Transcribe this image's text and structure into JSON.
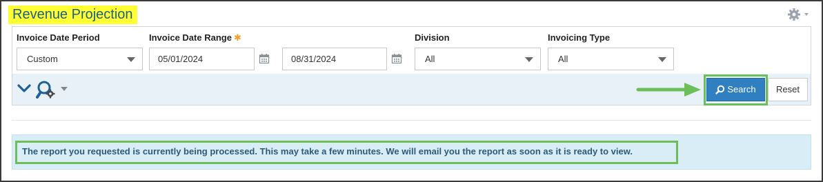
{
  "page": {
    "title": "Revenue Projection"
  },
  "header": {
    "settings_icon": "gear-icon",
    "settings_menu_icon": "caret-down-icon"
  },
  "filters": {
    "invoice_date_period": {
      "label": "Invoice Date Period",
      "value": "Custom"
    },
    "invoice_date_range": {
      "label": "Invoice Date Range",
      "required_marker": "✱",
      "start_value": "05/01/2024",
      "end_value": "08/31/2024",
      "calendar_icon": "calendar-icon"
    },
    "division": {
      "label": "Division",
      "value": "All"
    },
    "invoicing_type": {
      "label": "Invoicing Type",
      "value": "All"
    }
  },
  "toolbar": {
    "collapse_icon": "chevron-down-icon",
    "saved_searches_icon": "search-gear-icon",
    "search_label": "Search",
    "reset_label": "Reset",
    "annotation_arrow_icon": "arrow-right-icon"
  },
  "alert": {
    "message": "The report you requested is currently being processed. This may take a few minutes. We will email you the report as soon as it is ready to view."
  },
  "colors": {
    "title_highlight": "#ffff33",
    "title_text": "#1f5f86",
    "primary_button": "#2f7fc1",
    "annotation_green": "#6cbf58",
    "alert_background": "#d9edf7",
    "alert_text": "#2c5a78",
    "toolbar_background": "#e8f0f8"
  }
}
